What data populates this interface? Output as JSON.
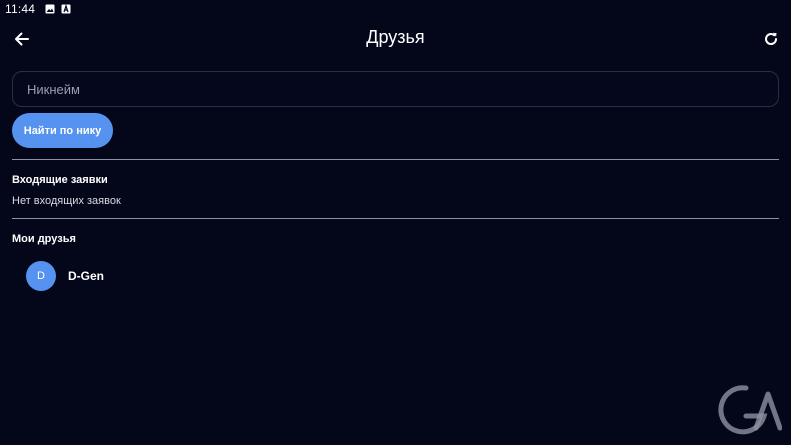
{
  "status_bar": {
    "time": "11:44",
    "icons": [
      "image-icon",
      "text-icon"
    ]
  },
  "app_bar": {
    "title": "Друзья",
    "back_icon": "arrow-left-icon",
    "refresh_icon": "refresh-icon"
  },
  "search": {
    "placeholder": "Никнейм",
    "value": "",
    "button_label": "Найти по нику"
  },
  "incoming": {
    "heading": "Входящие заявки",
    "empty_text": "Нет входящих заявок"
  },
  "friends": {
    "heading": "Мои друзья",
    "items": [
      {
        "initial": "D",
        "name": "D-Gen"
      }
    ]
  },
  "colors": {
    "background": "#04061a",
    "accent": "#5692ef",
    "divider": "#8c90a2"
  }
}
